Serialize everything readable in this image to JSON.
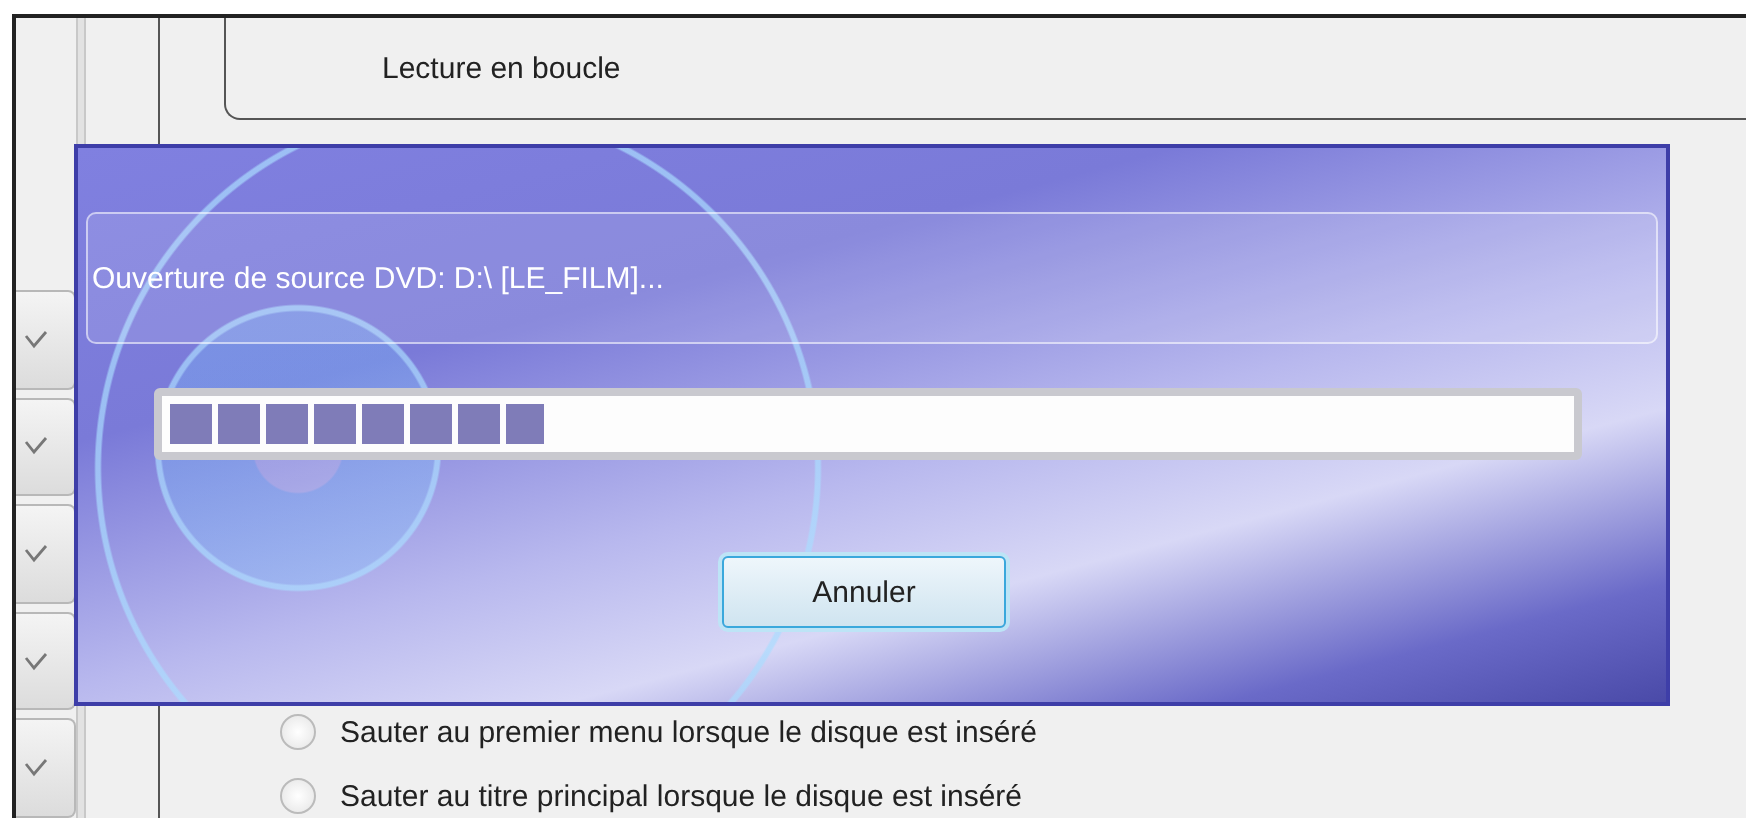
{
  "background_panel": {
    "loop_option": {
      "label": "Lecture en boucle"
    },
    "disc_options": [
      {
        "label": "Sauter au premier menu lorsque le disque est inséré",
        "selected": false
      },
      {
        "label": "Sauter au titre principal lorsque le disque est inséré",
        "selected": false
      }
    ]
  },
  "dialog": {
    "message": "Ouverture de source DVD: D:\\ [LE_FILM]...",
    "progress": {
      "level": 0.27
    },
    "buttons": [
      "Annuler"
    ]
  }
}
